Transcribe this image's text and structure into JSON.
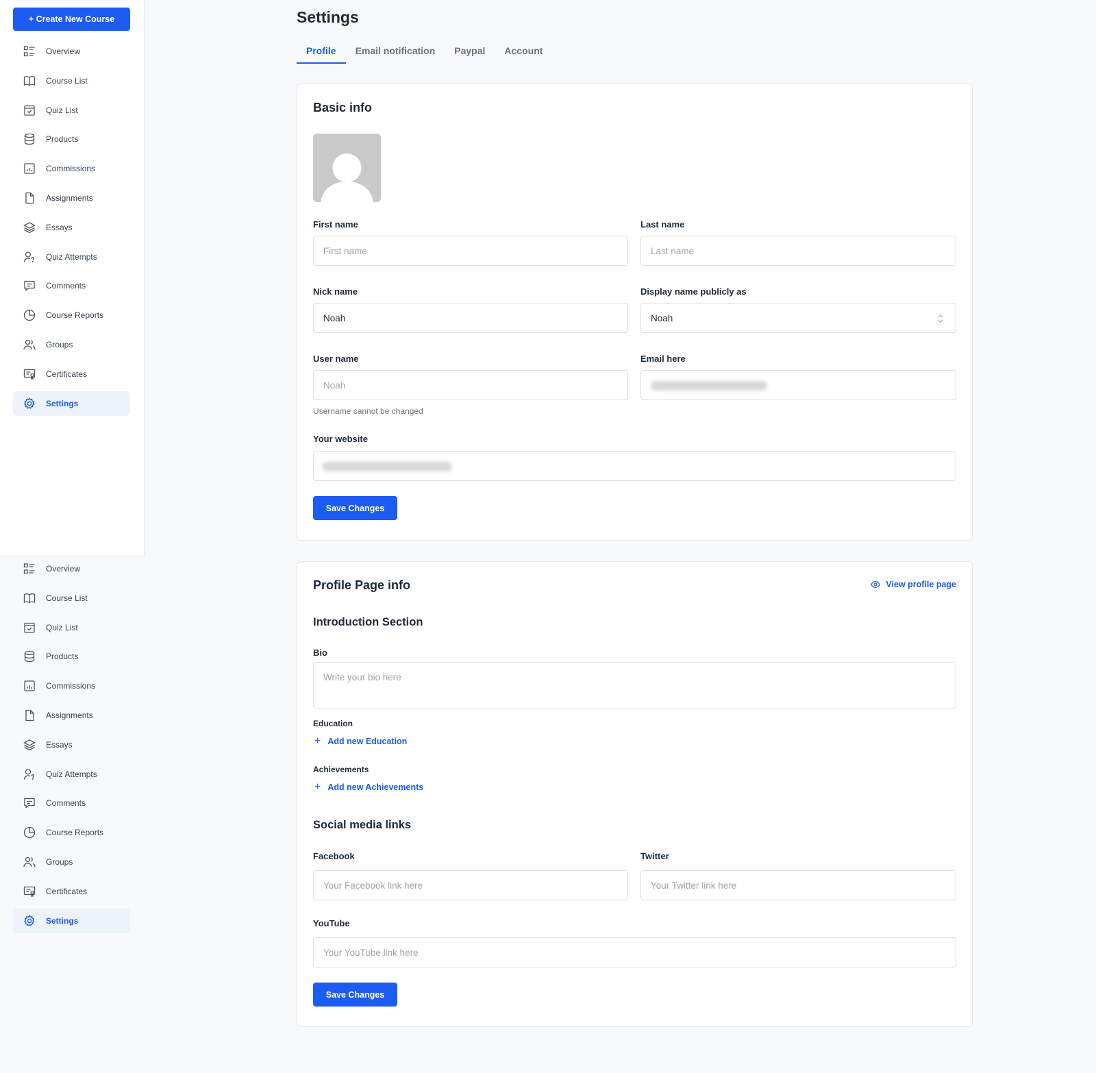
{
  "sidebar": {
    "create_label": "+ Create New Course",
    "items": [
      {
        "label": "Overview",
        "icon": "overview-icon"
      },
      {
        "label": "Course List",
        "icon": "book-icon"
      },
      {
        "label": "Quiz List",
        "icon": "quiz-icon"
      },
      {
        "label": "Products",
        "icon": "database-icon"
      },
      {
        "label": "Commissions",
        "icon": "chart-icon"
      },
      {
        "label": "Assignments",
        "icon": "file-icon"
      },
      {
        "label": "Essays",
        "icon": "layers-icon"
      },
      {
        "label": "Quiz Attempts",
        "icon": "user-question-icon"
      },
      {
        "label": "Comments",
        "icon": "comment-icon"
      },
      {
        "label": "Course Reports",
        "icon": "pie-chart-icon"
      },
      {
        "label": "Groups",
        "icon": "users-icon"
      },
      {
        "label": "Certificates",
        "icon": "certificate-icon"
      },
      {
        "label": "Settings",
        "icon": "gear-icon",
        "active": true
      }
    ]
  },
  "page": {
    "title": "Settings",
    "tabs": [
      {
        "label": "Profile",
        "active": true
      },
      {
        "label": "Email notification"
      },
      {
        "label": "Paypal"
      },
      {
        "label": "Account"
      }
    ]
  },
  "basic_info": {
    "heading": "Basic info",
    "first_name": {
      "label": "First name",
      "placeholder": "First name"
    },
    "last_name": {
      "label": "Last name",
      "placeholder": "Last name"
    },
    "nick_name": {
      "label": "Nick name",
      "value": "Noah"
    },
    "display_name": {
      "label": "Display name publicly as",
      "value": "Noah"
    },
    "user_name": {
      "label": "User name",
      "value": "Noah",
      "help": "Username cannot be changed"
    },
    "email": {
      "label": "Email here"
    },
    "website": {
      "label": "Your website"
    },
    "save_label": "Save Changes"
  },
  "profile_page": {
    "heading": "Profile Page info",
    "view_link": "View profile page",
    "intro_heading": "Introduction Section",
    "bio": {
      "label": "Bio",
      "placeholder": "Write your bio here"
    },
    "education": {
      "label": "Education",
      "add_label": "Add new Education"
    },
    "achievements": {
      "label": "Achievements",
      "add_label": "Add new Achievements"
    },
    "social_heading": "Social media links",
    "facebook": {
      "label": "Facebook",
      "placeholder": "Your Facebook link here"
    },
    "twitter": {
      "label": "Twitter",
      "placeholder": "Your Twitter link here"
    },
    "youtube": {
      "label": "YouTube",
      "placeholder": "Your YouTube link here"
    },
    "save_label": "Save Changes"
  },
  "colors": {
    "accent": "#1c5cf2",
    "active_bg": "#eef2fb"
  }
}
